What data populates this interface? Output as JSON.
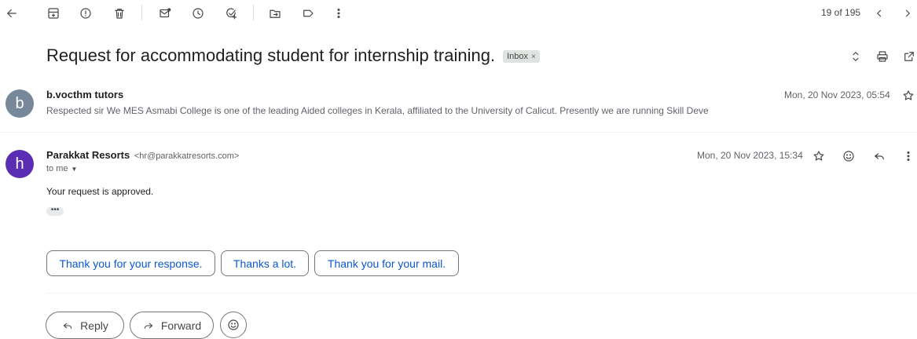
{
  "toolbar": {
    "icons": [
      "back-arrow-icon",
      "archive-icon",
      "report-spam-icon",
      "delete-icon",
      "mark-unread-icon",
      "snooze-icon",
      "add-task-icon",
      "move-to-icon",
      "label-icon",
      "more-vert-icon"
    ],
    "counter": "19 of 195"
  },
  "subject": {
    "title": "Request for accommodating student for internship training.",
    "label": "Inbox",
    "label_remove": "×"
  },
  "messages": [
    {
      "avatar_letter": "b",
      "avatar_color": "#77889a",
      "sender": "b.vocthm tutors",
      "snippet": "Respected sir We MES Asmabi College is one of the leading Aided colleges in Kerala, affiliated to the University of Calicut. Presently we are running Skill Deve",
      "date": "Mon, 20 Nov 2023, 05:54"
    },
    {
      "avatar_letter": "h",
      "avatar_color": "#5b2db3",
      "sender": "Parakkat Resorts",
      "email": "<hr@parakkatresorts.com>",
      "to": "to me",
      "date": "Mon, 20 Nov 2023, 15:34",
      "body": "Your request is approved.",
      "trimmed": "•••"
    }
  ],
  "smart_replies": [
    "Thank you for your response.",
    "Thanks a lot.",
    "Thank you for your mail."
  ],
  "actions": {
    "reply": "Reply",
    "forward": "Forward"
  },
  "colors": {
    "accent_blue": "#0b57d0",
    "text_primary": "#1f1f1f",
    "text_secondary": "#5f6368"
  }
}
